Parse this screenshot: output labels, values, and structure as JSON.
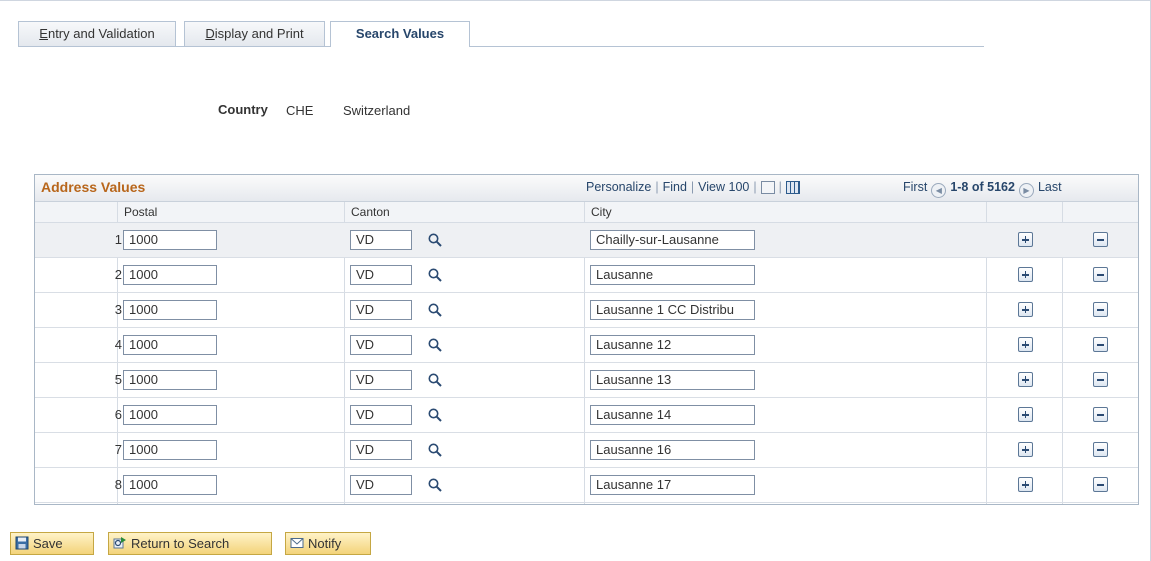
{
  "tabs": [
    {
      "label_mnemonic": "E",
      "label_rest": "ntry and Validation"
    },
    {
      "label_mnemonic": "D",
      "label_rest": "isplay and Print"
    },
    {
      "label": "Search Values"
    }
  ],
  "country": {
    "label": "Country",
    "code": "CHE",
    "name": "Switzerland"
  },
  "grid": {
    "title": "Address Values",
    "nav": {
      "personalize": "Personalize",
      "find": "Find",
      "view": "View 100"
    },
    "pager": {
      "first": "First",
      "range": "1-8 of 5162",
      "last": "Last"
    },
    "columns": {
      "postal": "Postal",
      "canton": "Canton",
      "city": "City"
    },
    "rows": [
      {
        "num": "1",
        "postal": "1000",
        "canton": "VD",
        "city": "Chailly-sur-Lausanne"
      },
      {
        "num": "2",
        "postal": "1000",
        "canton": "VD",
        "city": "Lausanne"
      },
      {
        "num": "3",
        "postal": "1000",
        "canton": "VD",
        "city": "Lausanne 1 CC Distribu"
      },
      {
        "num": "4",
        "postal": "1000",
        "canton": "VD",
        "city": "Lausanne 12"
      },
      {
        "num": "5",
        "postal": "1000",
        "canton": "VD",
        "city": "Lausanne 13"
      },
      {
        "num": "6",
        "postal": "1000",
        "canton": "VD",
        "city": "Lausanne 14"
      },
      {
        "num": "7",
        "postal": "1000",
        "canton": "VD",
        "city": "Lausanne 16"
      },
      {
        "num": "8",
        "postal": "1000",
        "canton": "VD",
        "city": "Lausanne 17"
      }
    ]
  },
  "toolbar": {
    "save": "Save",
    "return_to_search": "Return to Search",
    "notify": "Notify"
  },
  "icons": {
    "lookup": "magnifier-icon",
    "add_row": "plus-icon",
    "delete_row": "minus-icon",
    "zoom": "zoom-icon",
    "download": "grid-download-icon",
    "prev": "left-arrow-circle-icon",
    "next": "right-arrow-circle-icon"
  },
  "colors": {
    "grid_title": "#b8661b",
    "link": "#27466b",
    "button": "#f3d37a"
  }
}
